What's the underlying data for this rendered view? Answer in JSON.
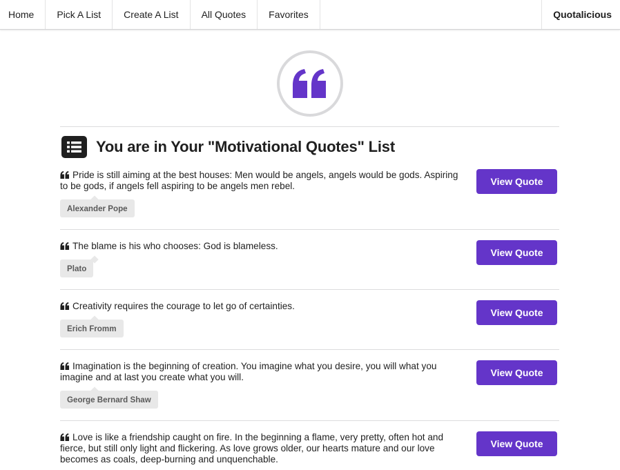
{
  "nav": {
    "items": [
      "Home",
      "Pick A List",
      "Create A List",
      "All Quotes",
      "Favorites"
    ],
    "brand": "Quotalicious"
  },
  "logo": {
    "icon": "quote-left-icon"
  },
  "heading": {
    "icon": "list-icon",
    "text": "You are in Your \"Motivational Quotes\" List"
  },
  "colors": {
    "accent": "#6435c9",
    "logo": "#6435c9",
    "label_bg": "#e8e8e8",
    "divider": "#dcdcdd"
  },
  "quotes": [
    {
      "text": "Pride is still aiming at the best houses: Men would be angels, angels would be gods. Aspiring to be gods, if angels fell aspiring to be angels men rebel.",
      "author": "Alexander Pope",
      "button": "View Quote"
    },
    {
      "text": "The blame is his who chooses: God is blameless.",
      "author": "Plato",
      "button": "View Quote"
    },
    {
      "text": "Creativity requires the courage to let go of certainties.",
      "author": "Erich Fromm",
      "button": "View Quote"
    },
    {
      "text": "Imagination is the beginning of creation. You imagine what you desire, you will what you imagine and at last you create what you will.",
      "author": "George Bernard Shaw",
      "button": "View Quote"
    },
    {
      "text": "Love is like a friendship caught on fire. In the beginning a flame, very pretty, often hot and fierce, but still only light and flickering. As love grows older, our hearts mature and our love becomes as coals, deep-burning and unquenchable.",
      "author": "",
      "button": "View Quote"
    }
  ]
}
